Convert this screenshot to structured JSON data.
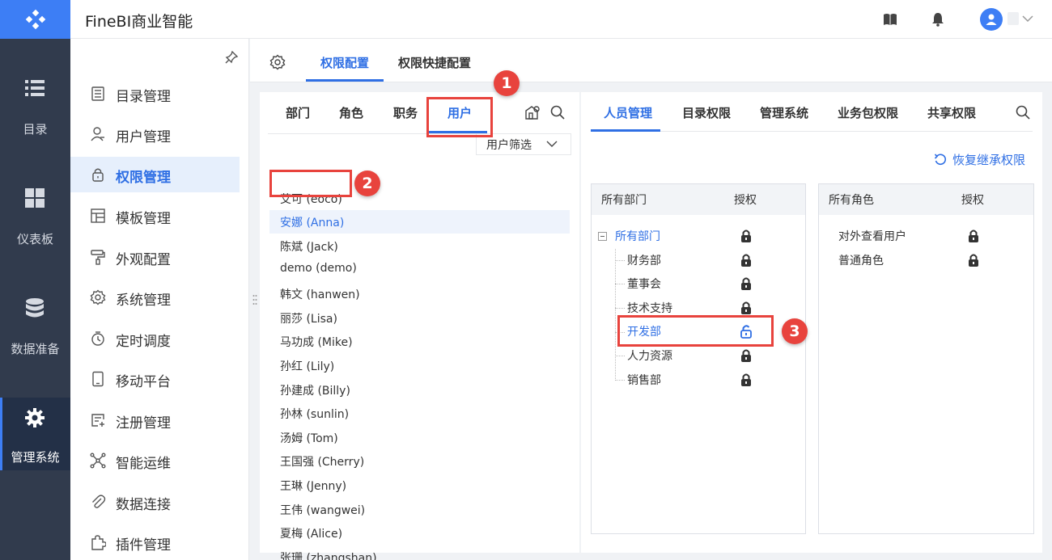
{
  "app": {
    "title": "FineBI商业智能"
  },
  "rail": {
    "items": [
      {
        "label": "目录",
        "icon": "list-icon"
      },
      {
        "label": "仪表板",
        "icon": "dashboard-grid-icon"
      },
      {
        "label": "数据准备",
        "icon": "database-icon"
      },
      {
        "label": "管理系统",
        "icon": "gear-icon",
        "active": true
      }
    ]
  },
  "sidebar": {
    "items": [
      {
        "label": "目录管理",
        "icon": "directory-icon"
      },
      {
        "label": "用户管理",
        "icon": "user-icon"
      },
      {
        "label": "权限管理",
        "icon": "lock-icon",
        "active": true
      },
      {
        "label": "模板管理",
        "icon": "template-icon"
      },
      {
        "label": "外观配置",
        "icon": "paint-roller-icon"
      },
      {
        "label": "系统管理",
        "icon": "gear-icon"
      },
      {
        "label": "定时调度",
        "icon": "timer-icon"
      },
      {
        "label": "移动平台",
        "icon": "mobile-icon"
      },
      {
        "label": "注册管理",
        "icon": "register-icon"
      },
      {
        "label": "智能运维",
        "icon": "network-icon"
      },
      {
        "label": "数据连接",
        "icon": "paperclip-icon"
      },
      {
        "label": "插件管理",
        "icon": "puzzle-icon"
      }
    ]
  },
  "top_tabs": {
    "config": "权限配置",
    "quick": "权限快捷配置"
  },
  "user_panel": {
    "tabs": {
      "dept": "部门",
      "role": "角色",
      "post": "职务",
      "user": "用户"
    },
    "filter_label": "用户筛选",
    "users": [
      "艾可 (eoco)",
      "安娜 (Anna)",
      "陈斌 (Jack)",
      "demo (demo)",
      "韩文 (hanwen)",
      "丽莎 (Lisa)",
      "马功成 (Mike)",
      "孙红 (Lily)",
      "孙建成 (Billy)",
      "孙林 (sunlin)",
      "汤姆 (Tom)",
      "王国强 (Cherry)",
      "王琳 (Jenny)",
      "王伟 (wangwei)",
      "夏梅 (Alice)",
      "张珊 (zhangshan)"
    ]
  },
  "perm_panel": {
    "tabs": {
      "people": "人员管理",
      "catalog": "目录权限",
      "system": "管理系统",
      "package": "业务包权限",
      "share": "共享权限"
    },
    "restore_label": "恢复继承权限",
    "dept_box": {
      "header_name": "所有部门",
      "header_auth": "授权",
      "root": "所有部门",
      "children": [
        "财务部",
        "董事会",
        "技术支持",
        "开发部",
        "人力资源",
        "销售部"
      ]
    },
    "role_box": {
      "header_name": "所有角色",
      "header_auth": "授权",
      "roles": [
        "对外查看用户",
        "普通角色"
      ]
    }
  },
  "annotations": {
    "badge1": "1",
    "badge2": "2",
    "badge3": "3"
  },
  "colors": {
    "accent": "#2f6fe4",
    "rail_bg": "#313b4d",
    "highlight": "#e8433d",
    "active_item_bg": "#e6effc"
  }
}
